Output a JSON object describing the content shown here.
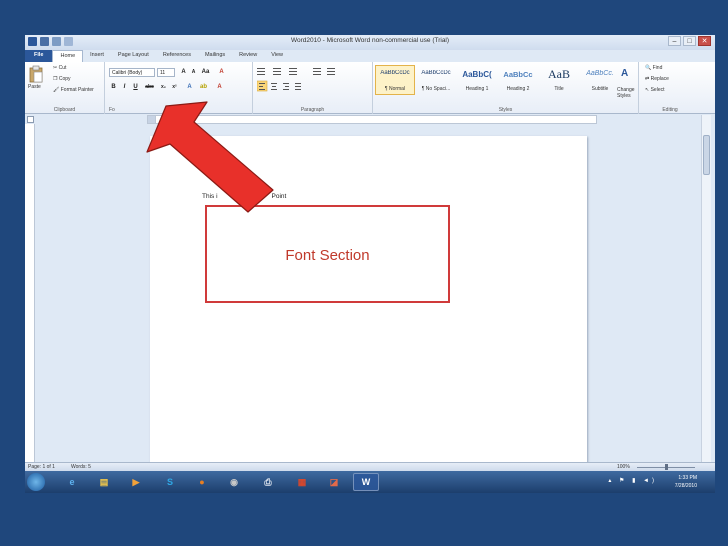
{
  "window": {
    "title": "Word2010 - Microsoft Word non-commercial use (Trial)",
    "controls": [
      "–",
      "□",
      "✕"
    ]
  },
  "tabs": [
    "File",
    "Home",
    "Insert",
    "Page Layout",
    "References",
    "Mailings",
    "Review",
    "View"
  ],
  "clipboard": {
    "paste_label": "Paste",
    "cut_label": "Cut",
    "copy_label": "Copy",
    "format_painter_label": "Format Painter",
    "group_label": "Clipboard"
  },
  "font": {
    "font_name": "Calibri (Body)",
    "font_size": "11",
    "group_label": "Fo"
  },
  "paragraph": {
    "group_label": "Paragraph"
  },
  "styles": {
    "group_label": "Styles",
    "items": [
      {
        "sample": "AaBbCcDc",
        "name": "¶ Normal"
      },
      {
        "sample": "AaBbCcDc",
        "name": "¶ No Spaci..."
      },
      {
        "sample": "AaBbC(",
        "name": "Heading 1"
      },
      {
        "sample": "AaBbCc",
        "name": "Heading 2"
      },
      {
        "sample": "AaB",
        "name": "Title"
      },
      {
        "sample": "AaBbCc.",
        "name": "Subtitle"
      }
    ],
    "change_styles_label": "Change Styles"
  },
  "editing": {
    "find_label": "Find",
    "replace_label": "Replace",
    "select_label": "Select",
    "group_label": "Editing"
  },
  "document": {
    "visible_text": "This i",
    "visible_text_tail": "Point"
  },
  "status": {
    "page": "Page: 1 of 1",
    "words": "Words: 5",
    "zoom": "100%"
  },
  "clock": {
    "time": "1:33 PM",
    "date": "7/28/2010"
  },
  "callout": {
    "text": "Font Section"
  },
  "colors": {
    "background": "#1f477c",
    "file_tab": "#2b579a",
    "arrow": "#e8302a",
    "callout_border": "#d03a3a"
  }
}
